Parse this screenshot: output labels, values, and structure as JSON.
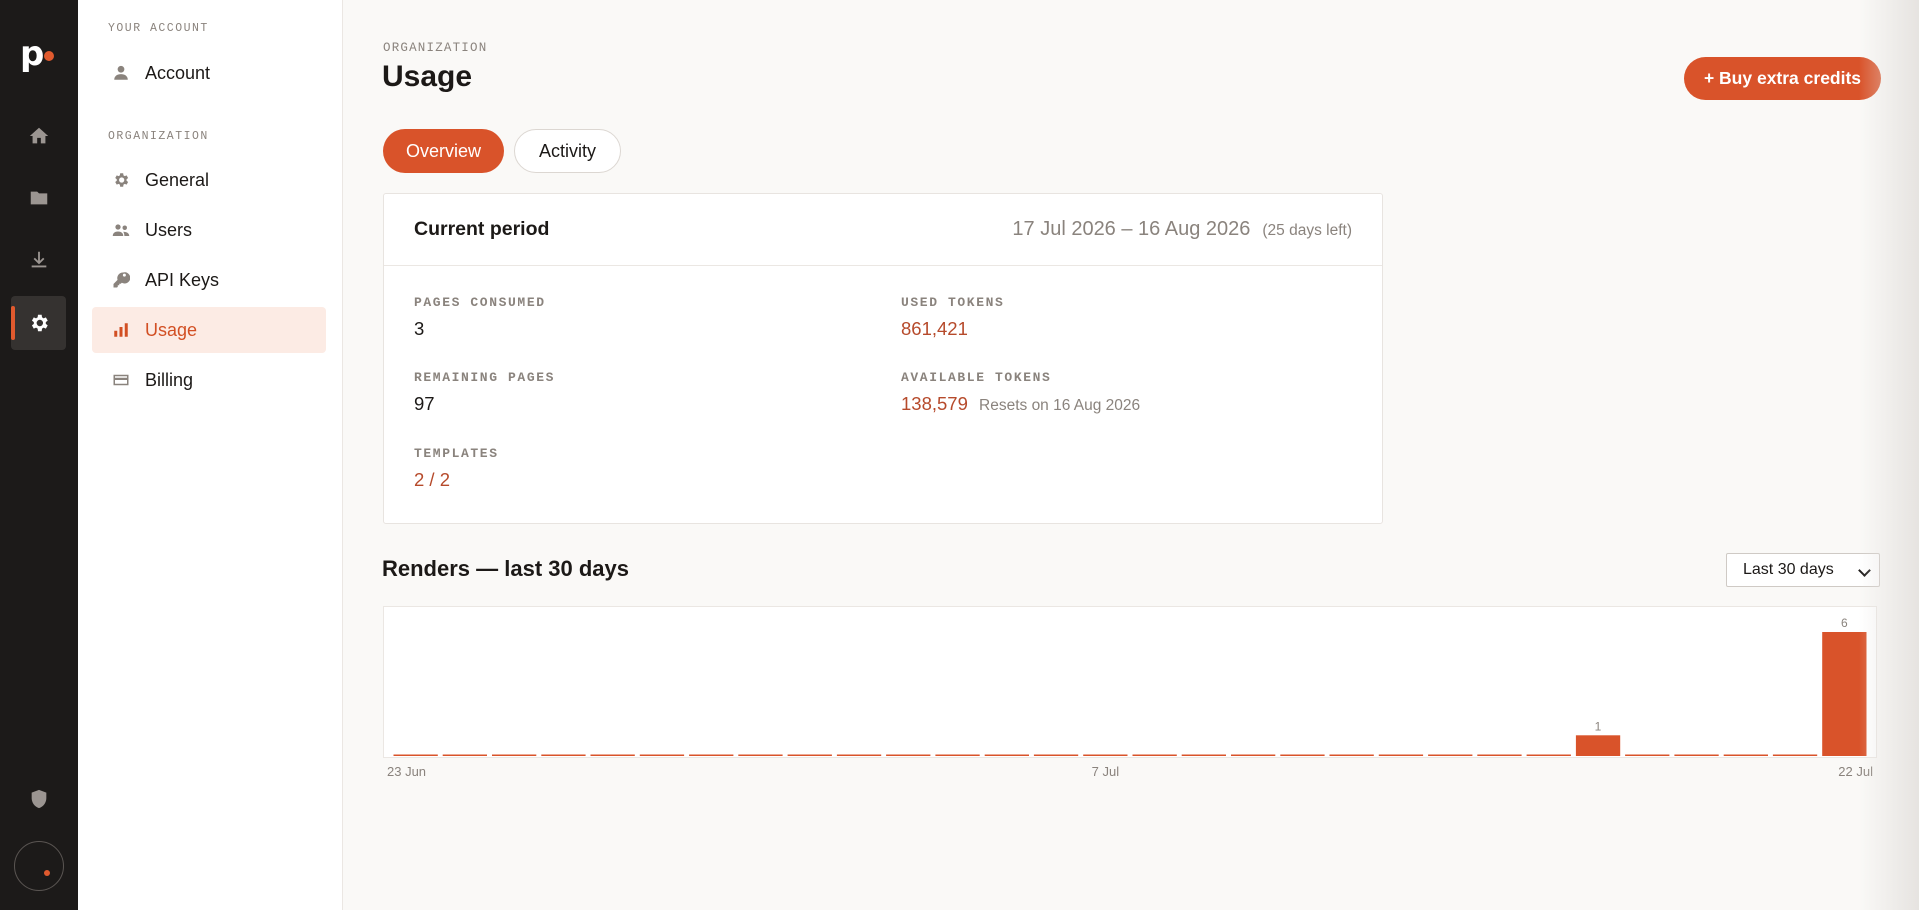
{
  "rail": {
    "logo": "p",
    "items": [
      {
        "icon": "home-icon"
      },
      {
        "icon": "folder-icon"
      },
      {
        "icon": "download-icon"
      },
      {
        "icon": "settings-icon",
        "active": true
      }
    ],
    "bottom_icon": "shield-icon"
  },
  "sidebar": {
    "account_section": "YOUR ACCOUNT",
    "account_item": "Account",
    "org_section": "ORGANIZATION",
    "items": [
      {
        "label": "General",
        "icon": "gear-icon"
      },
      {
        "label": "Users",
        "icon": "users-icon"
      },
      {
        "label": "API Keys",
        "icon": "key-icon"
      },
      {
        "label": "Usage",
        "icon": "bar-chart-icon",
        "active": true
      },
      {
        "label": "Billing",
        "icon": "credit-card-icon"
      }
    ]
  },
  "header": {
    "breadcrumb": "ORGANIZATION",
    "title": "Usage",
    "buy_button": "+ Buy extra credits"
  },
  "tabs": [
    {
      "label": "Overview",
      "active": true
    },
    {
      "label": "Activity",
      "active": false
    }
  ],
  "period": {
    "title": "Current period",
    "range": "17 Jul 2026 – 16 Aug 2026",
    "days_left": "(25 days left)",
    "stats": {
      "pages_consumed_label": "PAGES CONSUMED",
      "pages_consumed": "3",
      "used_tokens_label": "USED TOKENS",
      "used_tokens": "861,421",
      "remaining_pages_label": "REMAINING PAGES",
      "remaining_pages": "97",
      "available_tokens_label": "AVAILABLE TOKENS",
      "available_tokens": "138,579",
      "resets": "Resets on 16 Aug 2026",
      "templates_label": "TEMPLATES",
      "templates": "2 / 2"
    }
  },
  "renders": {
    "title": "Renders — last 30 days",
    "range_select": "Last 30 days"
  },
  "colors": {
    "accent": "#d9532a",
    "accent_text": "#b64a2b",
    "rail_bg": "#1c1a19"
  },
  "chart_data": {
    "type": "bar",
    "categories": [
      "23 Jun",
      "24 Jun",
      "25 Jun",
      "26 Jun",
      "27 Jun",
      "28 Jun",
      "29 Jun",
      "30 Jun",
      "1 Jul",
      "2 Jul",
      "3 Jul",
      "4 Jul",
      "5 Jul",
      "6 Jul",
      "7 Jul",
      "8 Jul",
      "9 Jul",
      "10 Jul",
      "11 Jul",
      "12 Jul",
      "13 Jul",
      "14 Jul",
      "15 Jul",
      "16 Jul",
      "17 Jul",
      "18 Jul",
      "19 Jul",
      "20 Jul",
      "21 Jul",
      "22 Jul"
    ],
    "values": [
      0,
      0,
      0,
      0,
      0,
      0,
      0,
      0,
      0,
      0,
      0,
      0,
      0,
      0,
      0,
      0,
      0,
      0,
      0,
      0,
      0,
      0,
      0,
      0,
      1,
      0,
      0,
      0,
      0,
      6
    ],
    "tick_labels": [
      "23 Jun",
      "7 Jul",
      "22 Jul"
    ],
    "ylim": [
      0,
      6
    ]
  }
}
